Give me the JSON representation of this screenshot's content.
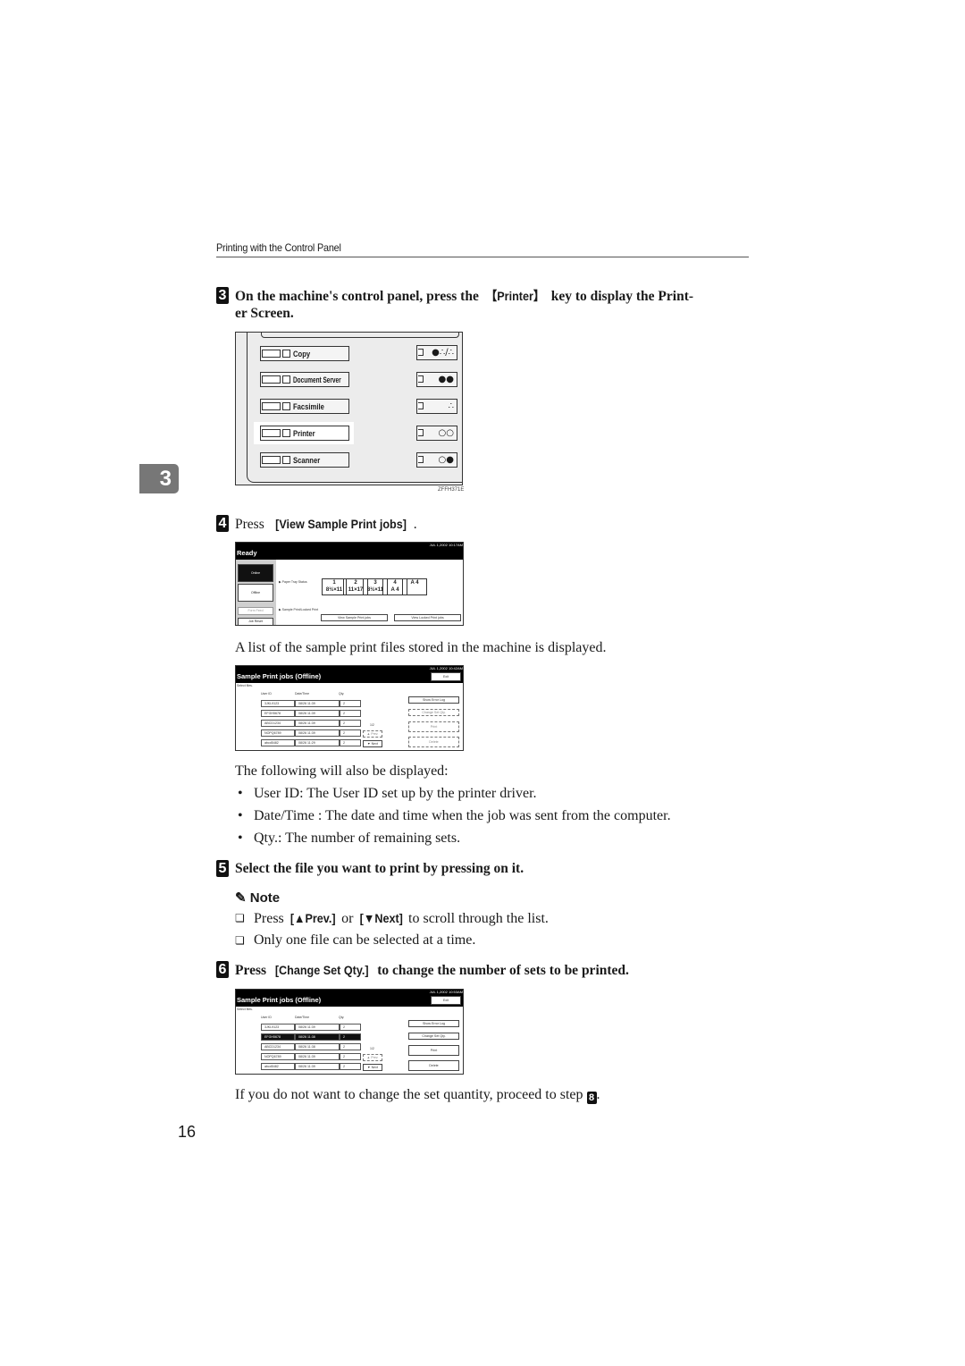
{
  "header": {
    "section_title": "Printing with the Control Panel"
  },
  "chapter_tab": "3",
  "page_number": "16",
  "steps": [
    {
      "number": "3",
      "text_before": "On the machine's control panel, press the ",
      "key": "【Printer】",
      "text_after": " key to display the Print-",
      "text_line2": "er Screen."
    },
    {
      "number": "4",
      "text_before": "Press ",
      "key": "[View Sample Print jobs]",
      "text_after": "."
    },
    {
      "number": "5",
      "text": "Select the file you want to print by pressing on it."
    },
    {
      "number": "6",
      "text_before": "Press ",
      "key": "[Change Set Qty.]",
      "text_after": " to change the number of sets to be printed."
    }
  ],
  "control_panel": {
    "mode_keys": [
      "Copy",
      "Document Server",
      "Facsimile",
      "Printer",
      "Scanner"
    ],
    "highlighted_key": "Printer",
    "status_icons": [
      "●∴/∴",
      "∴",
      "∴",
      "∴",
      "∴"
    ],
    "figure_code": "ZFFH371E"
  },
  "ready_screen": {
    "date": "JUL  1,2002 10:17AM",
    "title": "Ready",
    "side_buttons": [
      "Online",
      "Offline",
      "Form Feed",
      "Job Reset"
    ],
    "paper_tray_label": "▶ Paper Tray Status",
    "trays": [
      {
        "id": "1",
        "size": "8½×11"
      },
      {
        "id": "2",
        "size": "11×17"
      },
      {
        "id": "3",
        "size": "8½×11"
      },
      {
        "id": "4",
        "size": "A 4"
      },
      {
        "id": "",
        "size": "A 4"
      }
    ],
    "sample_locked_label": "▶ Sample Print/Locked Print",
    "view_sample_button": "View Sample Print jobs",
    "view_locked_button": "View Locked Print jobs"
  },
  "para_list_displayed": "A list of the sample print files stored in the machine is displayed.",
  "sample_screen_1": {
    "date": "JUL  1,2002 10:42AM",
    "title": "Sample Print jobs (Offline)",
    "exit_button": "Exit",
    "select_label": "Select files.",
    "columns": [
      "User ID",
      "Date/Time",
      "Qty."
    ],
    "rows": [
      [
        "3JKL9123",
        "08/26 11:39",
        "2"
      ],
      [
        "EFGH5678",
        "08/26 11:39",
        "2"
      ],
      [
        "ABCD1234",
        "08/26 11:39",
        "2"
      ],
      [
        "NOPQ6789",
        "08/26 11:39",
        "2"
      ],
      [
        "abcd5482",
        "08/26 11:29",
        "2"
      ]
    ],
    "page_indicator": "1/2",
    "prev_button": "▲ Prev.",
    "next_button": "▼ Next",
    "right_buttons": [
      "Show Error Log",
      "Change Set Qty.",
      "Print",
      "Delete"
    ],
    "selected_row": null
  },
  "para_following": "The following will also be displayed:",
  "bullets": [
    "User ID: The User ID set up by the printer driver.",
    "Date/Time : The date and time when the job was sent from the computer.",
    "Qty.: The number of remaining sets."
  ],
  "note": {
    "heading": "Note",
    "items": [
      {
        "before": "Press ",
        "key1": "[▲Prev.]",
        "mid": " or ",
        "key2": "[▼Next]",
        "after": " to scroll through the list."
      },
      {
        "text": "Only one file can be selected at a time."
      }
    ]
  },
  "sample_screen_2": {
    "date": "JUL  1,2002 10:53AM",
    "title": "Sample Print jobs (Offline)",
    "exit_button": "Exit",
    "select_label": "Select files.",
    "columns": [
      "User ID",
      "Date/Time",
      "Qty."
    ],
    "rows": [
      [
        "3JKL9123",
        "08/26 11:39",
        "2"
      ],
      [
        "EFGH5678",
        "08/26 11:38",
        "2"
      ],
      [
        "ABCD1234",
        "08/26 11:38",
        "2"
      ],
      [
        "NOPQ6789",
        "08/26 11:39",
        "2"
      ],
      [
        "abcd5482",
        "08/26 11:39",
        "2"
      ]
    ],
    "page_indicator": "1/2",
    "prev_button": "▲ Prev.",
    "next_button": "▼ Next",
    "right_buttons": [
      "Show Error Log",
      "Change Set Qty.",
      "Print",
      "Delete"
    ],
    "selected_row": 1
  },
  "final_para": {
    "text": "If you do not want to change the set quantity, proceed to step ",
    "step_ref": "8",
    "end": "."
  }
}
